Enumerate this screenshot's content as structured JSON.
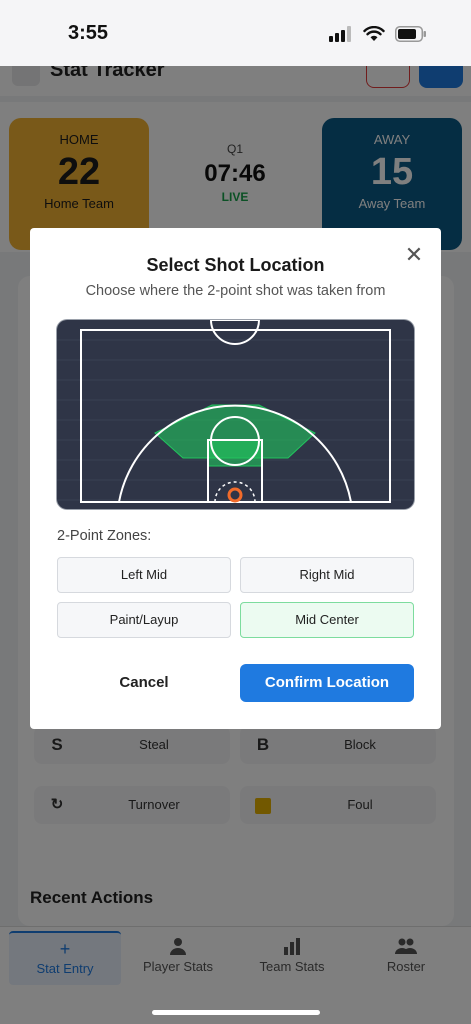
{
  "status_bar": {
    "time": "3:55",
    "icons": [
      "signal-icon",
      "wifi-icon",
      "battery-icon"
    ]
  },
  "app": {
    "title": "Stat Tracker",
    "home": {
      "label": "HOME",
      "score": "22",
      "name": "Home Team"
    },
    "away": {
      "label": "AWAY",
      "score": "15",
      "name": "Away Team"
    },
    "clock": {
      "quarter": "Q1",
      "time": "07:46",
      "status": "LIVE"
    },
    "actions": [
      {
        "key": "S",
        "label": "Steal"
      },
      {
        "key": "B",
        "label": "Block"
      },
      {
        "key": "",
        "label": "Turnover",
        "icon": "turnover-icon"
      },
      {
        "key": "",
        "label": "Foul",
        "icon": "foul-icon"
      }
    ],
    "recent_title": "Recent Actions",
    "tabs": [
      {
        "label": "Stat Entry",
        "icon": "plus-icon",
        "active": true
      },
      {
        "label": "Player Stats",
        "icon": "person-icon"
      },
      {
        "label": "Team Stats",
        "icon": "bar-chart-icon"
      },
      {
        "label": "Roster",
        "icon": "group-icon"
      }
    ]
  },
  "modal": {
    "title": "Select Shot Location",
    "subtitle": "Choose where the 2-point shot was taken from",
    "close_icon": "close-icon",
    "zones_label": "2-Point Zones:",
    "zones": [
      {
        "label": "Left Mid",
        "selected": false
      },
      {
        "label": "Right Mid",
        "selected": false
      },
      {
        "label": "Paint/Layup",
        "selected": false
      },
      {
        "label": "Mid Center",
        "selected": true
      }
    ],
    "highlighted_zone": "Mid Center",
    "cancel_label": "Cancel",
    "confirm_label": "Confirm Location"
  },
  "colors": {
    "accent": "#1f7ae0",
    "home": "#f3b233",
    "away": "#0b5a86",
    "live": "#17a34a",
    "court": "#2f3547",
    "zone_highlight": "#22c55e",
    "selected_zone_bg": "#ecfbf1"
  }
}
